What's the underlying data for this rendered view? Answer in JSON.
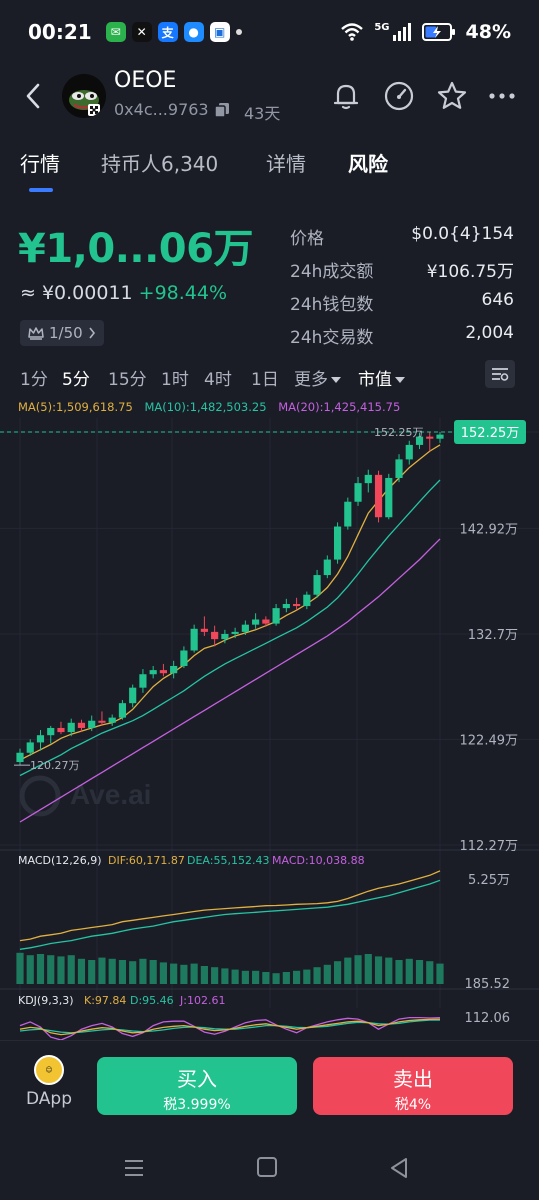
{
  "status_bar": {
    "time": "00:21",
    "network": "5G",
    "battery": "48%",
    "apps": [
      {
        "name": "wechat-icon",
        "color": "#2bb24c",
        "glyph": "✉"
      },
      {
        "name": "okx-icon",
        "color": "#111111",
        "glyph": "✕"
      },
      {
        "name": "alipay-icon",
        "color": "#1677ff",
        "glyph": "支"
      },
      {
        "name": "app-icon",
        "color": "#1e8bff",
        "glyph": "●"
      },
      {
        "name": "bank-icon",
        "color": "#ffffff",
        "glyph": "▣"
      }
    ]
  },
  "header": {
    "token_name": "OEOE",
    "address": "0x4c...9763",
    "age": "43天"
  },
  "tabs": [
    {
      "label": "行情"
    },
    {
      "label": "持币人6,340"
    },
    {
      "label": "详情"
    },
    {
      "label": "风险"
    }
  ],
  "price": {
    "big": "¥1,0...06万",
    "approx_prefix": "≈ ¥0.00011",
    "change": "+98.44%",
    "rank": "1/50"
  },
  "stats": [
    {
      "label": "价格",
      "value": "$0.0{4}154"
    },
    {
      "label": "24h成交额",
      "value": "¥106.75万"
    },
    {
      "label": "24h钱包数",
      "value": "646"
    },
    {
      "label": "24h交易数",
      "value": "2,004"
    }
  ],
  "timeframes": [
    "1分",
    "5分",
    "15分",
    "1时",
    "4时",
    "1日",
    "更多",
    "市值"
  ],
  "active_timeframe": "5分",
  "ma_legend": {
    "ma5": "MA(5):1,509,618.75",
    "ma10": "MA(10):1,482,503.25",
    "ma20": "MA(20):1,425,415.75"
  },
  "macd_legend": {
    "title": "MACD(12,26,9)",
    "dif": "DIF:60,171.87",
    "dea": "DEA:55,152.43",
    "macd": "MACD:10,038.88"
  },
  "kdj_legend": {
    "title": "KDJ(9,3,3)",
    "k": "K:97.84",
    "d": "D:95.46",
    "j": "J:102.61"
  },
  "watermark": "Ave.ai",
  "actions": {
    "dapp": "DApp",
    "buy": "买入",
    "buy_tax": "税3.999%",
    "sell": "卖出",
    "sell_tax": "税4%"
  },
  "colors": {
    "up": "#22c38e",
    "down": "#f0475a",
    "ma5": "#e0b040",
    "ma10": "#25c4a5",
    "ma20": "#c560e0",
    "accent": "#3a7bff"
  },
  "chart_data": [
    {
      "type": "candlestick",
      "title": "",
      "unit": "万",
      "y_ticks": [
        "152.25万",
        "142.92万",
        "132.7万",
        "122.49万",
        "112.27万"
      ],
      "y_tick_values": [
        152.25,
        142.92,
        132.7,
        122.49,
        112.27
      ],
      "ylim": [
        112.27,
        154.0
      ],
      "last_price_label": "152.25万",
      "high_marker": "152.25万",
      "low_marker": "120.27万",
      "candles": [
        {
          "o": 120.3,
          "h": 121.6,
          "l": 120.0,
          "c": 121.2
        },
        {
          "o": 121.2,
          "h": 122.5,
          "l": 120.9,
          "c": 122.2
        },
        {
          "o": 122.2,
          "h": 123.4,
          "l": 121.4,
          "c": 122.9
        },
        {
          "o": 122.9,
          "h": 123.8,
          "l": 122.1,
          "c": 123.6
        },
        {
          "o": 123.6,
          "h": 124.2,
          "l": 123.0,
          "c": 123.2
        },
        {
          "o": 123.2,
          "h": 124.5,
          "l": 122.8,
          "c": 124.1
        },
        {
          "o": 124.1,
          "h": 124.4,
          "l": 123.2,
          "c": 123.6
        },
        {
          "o": 123.6,
          "h": 124.8,
          "l": 123.3,
          "c": 124.3
        },
        {
          "o": 124.3,
          "h": 125.2,
          "l": 123.8,
          "c": 124.1
        },
        {
          "o": 124.1,
          "h": 124.9,
          "l": 123.8,
          "c": 124.6
        },
        {
          "o": 124.6,
          "h": 126.3,
          "l": 124.4,
          "c": 126.0
        },
        {
          "o": 126.0,
          "h": 127.8,
          "l": 125.6,
          "c": 127.5
        },
        {
          "o": 127.5,
          "h": 129.3,
          "l": 127.0,
          "c": 128.8
        },
        {
          "o": 128.8,
          "h": 129.6,
          "l": 128.4,
          "c": 129.2
        },
        {
          "o": 129.2,
          "h": 129.8,
          "l": 128.6,
          "c": 128.9
        },
        {
          "o": 128.9,
          "h": 130.1,
          "l": 128.4,
          "c": 129.6
        },
        {
          "o": 129.6,
          "h": 131.5,
          "l": 129.4,
          "c": 131.1
        },
        {
          "o": 131.1,
          "h": 133.6,
          "l": 130.9,
          "c": 133.2
        },
        {
          "o": 133.2,
          "h": 134.4,
          "l": 132.5,
          "c": 132.9
        },
        {
          "o": 132.9,
          "h": 133.5,
          "l": 131.5,
          "c": 132.2
        },
        {
          "o": 132.2,
          "h": 133.1,
          "l": 131.8,
          "c": 132.7
        },
        {
          "o": 132.7,
          "h": 133.3,
          "l": 132.3,
          "c": 132.9
        },
        {
          "o": 132.9,
          "h": 134.0,
          "l": 132.6,
          "c": 133.6
        },
        {
          "o": 133.6,
          "h": 134.7,
          "l": 133.2,
          "c": 134.1
        },
        {
          "o": 134.1,
          "h": 134.4,
          "l": 133.4,
          "c": 133.7
        },
        {
          "o": 133.7,
          "h": 135.6,
          "l": 133.5,
          "c": 135.2
        },
        {
          "o": 135.2,
          "h": 136.1,
          "l": 134.8,
          "c": 135.6
        },
        {
          "o": 135.6,
          "h": 136.2,
          "l": 135.0,
          "c": 135.4
        },
        {
          "o": 135.4,
          "h": 136.8,
          "l": 135.1,
          "c": 136.5
        },
        {
          "o": 136.5,
          "h": 138.9,
          "l": 136.2,
          "c": 138.4
        },
        {
          "o": 138.4,
          "h": 140.3,
          "l": 138.1,
          "c": 139.9
        },
        {
          "o": 139.9,
          "h": 143.5,
          "l": 139.5,
          "c": 143.1
        },
        {
          "o": 143.1,
          "h": 145.9,
          "l": 142.8,
          "c": 145.5
        },
        {
          "o": 145.5,
          "h": 147.9,
          "l": 145.1,
          "c": 147.3
        },
        {
          "o": 147.3,
          "h": 148.6,
          "l": 146.4,
          "c": 148.1
        },
        {
          "o": 148.1,
          "h": 148.5,
          "l": 143.5,
          "c": 144.0
        },
        {
          "o": 144.0,
          "h": 148.2,
          "l": 143.8,
          "c": 147.8
        },
        {
          "o": 147.8,
          "h": 150.1,
          "l": 147.4,
          "c": 149.6
        },
        {
          "o": 149.6,
          "h": 151.4,
          "l": 149.1,
          "c": 151.0
        },
        {
          "o": 151.0,
          "h": 152.2,
          "l": 150.6,
          "c": 151.8
        },
        {
          "o": 151.8,
          "h": 152.25,
          "l": 150.4,
          "c": 151.6
        },
        {
          "o": 151.6,
          "h": 152.25,
          "l": 151.2,
          "c": 152.0
        }
      ],
      "ma5": [
        120.5,
        121.0,
        121.5,
        122.0,
        122.6,
        123.0,
        123.3,
        123.6,
        123.9,
        124.1,
        124.6,
        125.4,
        126.5,
        127.6,
        128.4,
        129.0,
        129.7,
        130.6,
        131.3,
        131.6,
        132.1,
        132.5,
        132.8,
        133.1,
        133.5,
        133.9,
        134.5,
        135.0,
        135.6,
        136.3,
        137.2,
        138.5,
        140.2,
        142.3,
        144.4,
        145.6,
        146.8,
        147.8,
        148.8,
        149.6,
        150.4,
        151.0
      ],
      "ma10": [
        119.0,
        119.5,
        120.0,
        120.5,
        121.0,
        121.6,
        122.1,
        122.6,
        123.1,
        123.5,
        123.9,
        124.3,
        124.8,
        125.4,
        126.0,
        126.6,
        127.2,
        127.9,
        128.6,
        129.2,
        129.8,
        130.3,
        130.8,
        131.3,
        131.8,
        132.3,
        132.8,
        133.3,
        133.9,
        134.6,
        135.3,
        136.2,
        137.3,
        138.5,
        139.8,
        141.0,
        142.2,
        143.3,
        144.4,
        145.5,
        146.6,
        147.6
      ],
      "ma20": [
        114.5,
        115.1,
        115.7,
        116.3,
        116.9,
        117.5,
        118.1,
        118.7,
        119.3,
        119.9,
        120.5,
        121.1,
        121.7,
        122.3,
        122.9,
        123.5,
        124.1,
        124.7,
        125.3,
        125.9,
        126.5,
        127.1,
        127.7,
        128.3,
        128.9,
        129.5,
        130.1,
        130.7,
        131.3,
        131.9,
        132.5,
        133.2,
        133.9,
        134.7,
        135.5,
        136.3,
        137.2,
        138.1,
        139.0,
        139.9,
        140.9,
        141.9
      ]
    },
    {
      "type": "macd",
      "y_ticks": [
        "5.25万",
        "185.52"
      ],
      "dif": [
        1.2,
        1.3,
        1.5,
        1.6,
        1.7,
        1.9,
        2.0,
        2.1,
        2.2,
        2.3,
        2.5,
        2.6,
        2.7,
        2.8,
        2.9,
        3.0,
        3.1,
        3.2,
        3.3,
        3.35,
        3.4,
        3.45,
        3.5,
        3.55,
        3.6,
        3.62,
        3.65,
        3.7,
        3.72,
        3.75,
        3.8,
        3.9,
        4.1,
        4.35,
        4.6,
        4.8,
        4.95,
        5.1,
        5.3,
        5.5,
        5.7,
        6.0
      ],
      "dea": [
        0.6,
        0.7,
        0.85,
        1.0,
        1.1,
        1.2,
        1.35,
        1.5,
        1.6,
        1.7,
        1.85,
        2.0,
        2.1,
        2.2,
        2.35,
        2.5,
        2.6,
        2.7,
        2.8,
        2.9,
        3.0,
        3.05,
        3.1,
        3.15,
        3.2,
        3.25,
        3.3,
        3.35,
        3.4,
        3.45,
        3.5,
        3.6,
        3.7,
        3.85,
        4.0,
        4.15,
        4.3,
        4.5,
        4.7,
        4.9,
        5.1,
        5.35
      ],
      "hist": [
        1.3,
        1.2,
        1.25,
        1.2,
        1.15,
        1.2,
        1.05,
        1.0,
        1.1,
        1.05,
        1.0,
        0.95,
        1.05,
        1.0,
        0.9,
        0.85,
        0.8,
        0.85,
        0.75,
        0.7,
        0.65,
        0.6,
        0.55,
        0.55,
        0.5,
        0.45,
        0.5,
        0.55,
        0.6,
        0.7,
        0.8,
        0.95,
        1.1,
        1.2,
        1.25,
        1.15,
        1.1,
        1.0,
        1.05,
        1.0,
        0.95,
        0.85
      ]
    },
    {
      "type": "kdj",
      "y_ticks": [
        "112.06"
      ],
      "k": [
        70,
        75,
        72,
        60,
        55,
        58,
        65,
        70,
        74,
        72,
        65,
        60,
        62,
        70,
        75,
        78,
        80,
        76,
        70,
        66,
        68,
        72,
        78,
        82,
        85,
        80,
        75,
        70,
        74,
        78,
        82,
        86,
        90,
        92,
        88,
        80,
        84,
        90,
        94,
        96,
        97,
        98
      ],
      "d": [
        65,
        68,
        70,
        66,
        62,
        60,
        62,
        65,
        68,
        70,
        68,
        65,
        63,
        65,
        68,
        72,
        75,
        76,
        74,
        71,
        70,
        70,
        73,
        76,
        80,
        80,
        78,
        75,
        74,
        76,
        78,
        82,
        86,
        89,
        88,
        85,
        84,
        86,
        90,
        93,
        95,
        95
      ],
      "j": [
        80,
        90,
        76,
        48,
        40,
        52,
        70,
        80,
        86,
        76,
        58,
        50,
        60,
        80,
        90,
        92,
        92,
        78,
        62,
        56,
        64,
        76,
        88,
        94,
        96,
        82,
        70,
        60,
        74,
        82,
        90,
        96,
        100,
        98,
        88,
        70,
        84,
        98,
        102,
        102,
        101,
        102
      ]
    }
  ]
}
